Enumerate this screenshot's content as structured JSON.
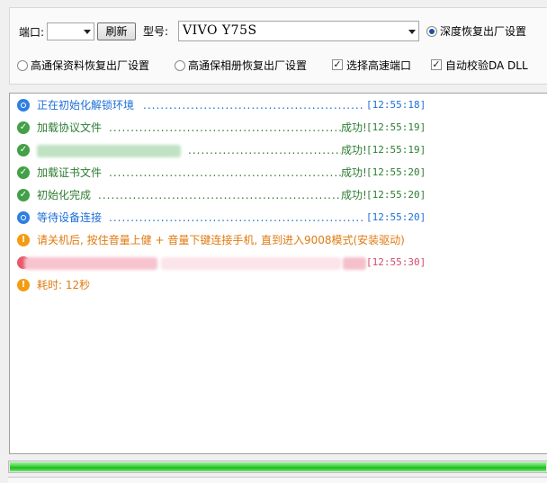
{
  "toolbar": {
    "port_label": "端口:",
    "port_value": "",
    "refresh_label": "刷新",
    "model_label": "型号:",
    "model_value": "VIVO Y75S",
    "options": [
      {
        "label": "深度恢复出厂设置",
        "type": "radio",
        "checked": true
      },
      {
        "label": "高通保资料恢复出厂设置",
        "type": "radio",
        "checked": false
      },
      {
        "label": "高通保相册恢复出厂设置",
        "type": "radio",
        "checked": false
      },
      {
        "label": "选择高速端口",
        "type": "checkbox",
        "checked": true
      },
      {
        "label": "自动校验DA DLL",
        "type": "checkbox",
        "checked": true
      }
    ]
  },
  "log": [
    {
      "icon": "info",
      "message": "正在初始化解锁环境",
      "status": "",
      "time": "[12:55:18]",
      "color": "#1d6fd6"
    },
    {
      "icon": "ok",
      "message": "加载协议文件",
      "status": "成功!",
      "time": "[12:55:19]",
      "color": "#2e7d32"
    },
    {
      "icon": "ok",
      "message": "",
      "status": "成功!",
      "time": "[12:55:19]",
      "color": "#2e7d32"
    },
    {
      "icon": "ok",
      "message": "加载证书文件",
      "status": "成功!",
      "time": "[12:55:20]",
      "color": "#2e7d32"
    },
    {
      "icon": "ok",
      "message": "初始化完成",
      "status": "成功!",
      "time": "[12:55:20]",
      "color": "#2e7d32"
    },
    {
      "icon": "info",
      "message": "等待设备连接",
      "status": "",
      "time": "[12:55:20]",
      "color": "#1d6fd6"
    },
    {
      "icon": "warn",
      "message": "请关机后, 按住音量上健 + 音量下键连接手机, 直到进入9008模式(安装驱动)",
      "status": "",
      "time": "",
      "color": "#e07a10"
    },
    {
      "icon": "err",
      "message": "",
      "status": "",
      "time": "[12:55:30]",
      "color": "#d24b6f"
    },
    {
      "icon": "warn",
      "message": "耗时: 12秒",
      "status": "",
      "time": "",
      "color": "#e07a10"
    }
  ],
  "progress": {
    "percent": 100
  }
}
